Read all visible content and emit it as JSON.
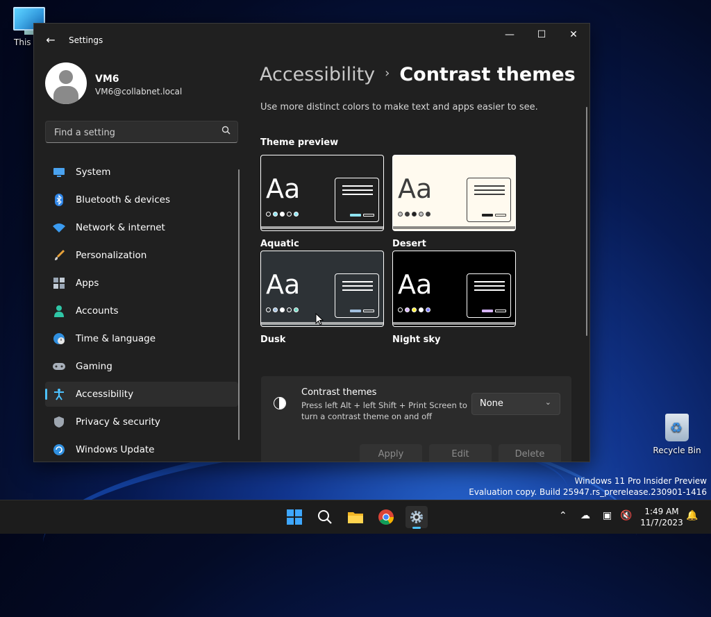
{
  "desktop": {
    "this_pc_label": "This PC",
    "recycle_bin_label": "Recycle Bin",
    "watermark_line1": "Windows 11 Pro Insider Preview",
    "watermark_line2": "Evaluation copy. Build 25947.rs_prerelease.230901-1416"
  },
  "window": {
    "title": "Settings",
    "back_icon": "back-arrow-icon",
    "controls": [
      "minimize",
      "maximize",
      "close"
    ]
  },
  "profile": {
    "name": "VM6",
    "email": "VM6@collabnet.local"
  },
  "search": {
    "placeholder": "Find a setting"
  },
  "sidebar": {
    "items": [
      {
        "label": "System",
        "icon": "monitor-icon",
        "active": false
      },
      {
        "label": "Bluetooth & devices",
        "icon": "bluetooth-icon",
        "active": false
      },
      {
        "label": "Network & internet",
        "icon": "wifi-icon",
        "active": false
      },
      {
        "label": "Personalization",
        "icon": "brush-icon",
        "active": false
      },
      {
        "label": "Apps",
        "icon": "apps-icon",
        "active": false
      },
      {
        "label": "Accounts",
        "icon": "person-icon",
        "active": false
      },
      {
        "label": "Time & language",
        "icon": "globe-clock-icon",
        "active": false
      },
      {
        "label": "Gaming",
        "icon": "gamepad-icon",
        "active": false
      },
      {
        "label": "Accessibility",
        "icon": "accessibility-icon",
        "active": true
      },
      {
        "label": "Privacy & security",
        "icon": "shield-icon",
        "active": false
      },
      {
        "label": "Windows Update",
        "icon": "update-icon",
        "active": false
      }
    ]
  },
  "main": {
    "breadcrumb_parent": "Accessibility",
    "breadcrumb_current": "Contrast themes",
    "description": "Use more distinct colors to make text and apps easier to see.",
    "preview_heading": "Theme preview",
    "themes": [
      {
        "name": "Aquatic",
        "aa": "Aa",
        "bg": "#202020",
        "fg": "#ffffff",
        "accent": "#8ee3f0",
        "dots": [
          "#202020",
          "#8ee3f0",
          "#ffffff",
          "#202020",
          "#8ee3f0"
        ]
      },
      {
        "name": "Desert",
        "aa": "Aa",
        "bg": "#fffaef",
        "fg": "#3d3d3d",
        "accent": "#202020",
        "dots": [
          "#c2c2c2",
          "#3d3d3d",
          "#202020",
          "#c2c2c2",
          "#3d3d3d"
        ]
      },
      {
        "name": "Dusk",
        "aa": "Aa",
        "bg": "#2d3236",
        "fg": "#ffffff",
        "accent": "#a1bfde",
        "dots": [
          "#2d3236",
          "#a1bfde",
          "#ffffff",
          "#2d3236",
          "#6fd7c2"
        ]
      },
      {
        "name": "Night sky",
        "aa": "Aa",
        "bg": "#000000",
        "fg": "#ffffff",
        "accent": "#d6b4fd",
        "dots": [
          "#000000",
          "#d6b4fd",
          "#ffee32",
          "#ffffff",
          "#8080ff"
        ]
      }
    ],
    "panel": {
      "title": "Contrast themes",
      "description": "Press left Alt + left Shift + Print Screen to turn a contrast theme on and off",
      "dropdown_value": "None",
      "apply_label": "Apply",
      "edit_label": "Edit",
      "delete_label": "Delete"
    }
  },
  "taskbar": {
    "time": "1:49 AM",
    "date": "11/7/2023",
    "apps": [
      "start-icon",
      "search-icon",
      "file-explorer-icon",
      "chrome-icon",
      "settings-icon"
    ]
  }
}
